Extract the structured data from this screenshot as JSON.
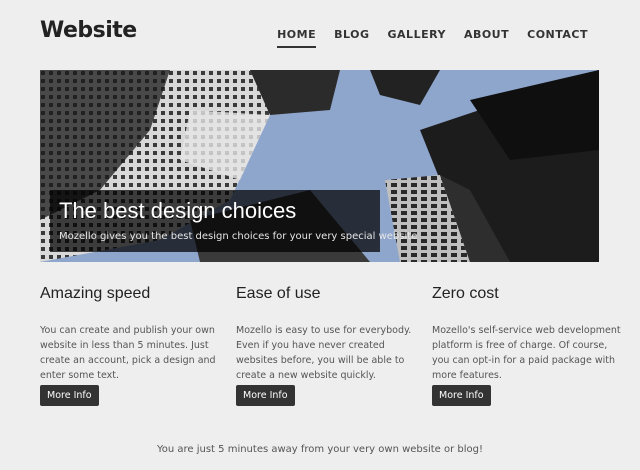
{
  "header": {
    "brand": "Website",
    "nav": [
      "HOME",
      "BLOG",
      "GALLERY",
      "ABOUT",
      "CONTACT"
    ],
    "active_nav": "HOME"
  },
  "hero": {
    "title": "The best design choices",
    "subtitle": "Mozello gives you the best design choices for your very special website"
  },
  "features": [
    {
      "title": "Amazing speed",
      "text": "You can create and publish your own website in less than 5 minutes. Just create an account, pick a design and enter some text.",
      "button": "More Info"
    },
    {
      "title": "Ease of use",
      "text": "Mozello is easy to use for everybody. Even if you have never created websites before, you will be able to create a new website quickly.",
      "button": "More Info"
    },
    {
      "title": "Zero cost",
      "text": "Mozello's self-service web development platform is free of charge. Of course, you can opt-in for a paid package with more features.",
      "button": "More Info"
    }
  ],
  "footer": {
    "tagline": "You are just 5 minutes away from your very own website or blog!"
  },
  "colors": {
    "background": "#eeeeee",
    "button": "#333333",
    "caption_bg": "rgba(0,0,0,0.72)"
  }
}
